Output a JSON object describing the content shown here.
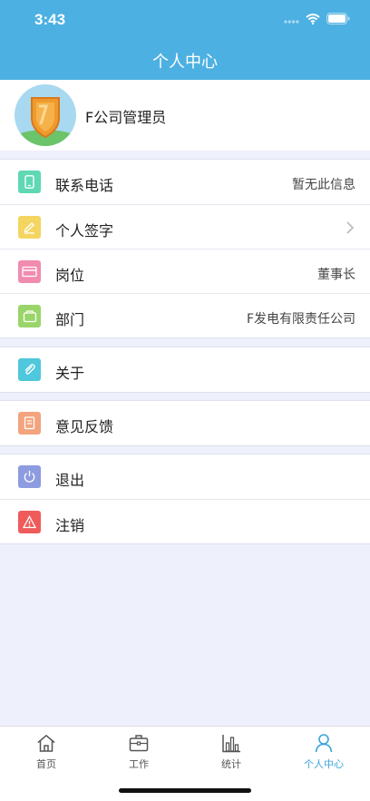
{
  "status_bar": {
    "time": "3:43",
    "icons": [
      "signal-icon",
      "wifi-icon",
      "battery-icon"
    ]
  },
  "header": {
    "title": "个人中心",
    "background": "#4db0e2"
  },
  "profile": {
    "name": "F公司管理员",
    "avatar_icon": "shield-icon"
  },
  "groups": {
    "info": [
      {
        "label": "联系电话",
        "value": "暂无此信息",
        "icon": "phone-icon",
        "color": "#5fd8b4"
      },
      {
        "label": "个人签字",
        "value": "",
        "icon": "pen-icon",
        "color": "#f4d560"
      },
      {
        "label": "岗位",
        "value": "董事长",
        "icon": "card-icon",
        "color": "#f28bb0"
      },
      {
        "label": "部门",
        "value": "F发电有限责任公司",
        "icon": "folder-icon",
        "color": "#9ad56a"
      }
    ],
    "about": [
      {
        "label": "关于",
        "icon": "paperclip-icon",
        "color": "#4fc7dc"
      }
    ],
    "feedback": [
      {
        "label": "意见反馈",
        "icon": "document-icon",
        "color": "#f3a47e"
      }
    ],
    "account": [
      {
        "label": "退出",
        "icon": "power-icon",
        "color": "#8d9be0"
      },
      {
        "label": "注销",
        "icon": "warning-icon",
        "color": "#ef5b5b"
      }
    ]
  },
  "tabbar": {
    "tabs": [
      {
        "label": "首页",
        "icon": "home-icon"
      },
      {
        "label": "工作",
        "icon": "briefcase-icon"
      },
      {
        "label": "统计",
        "icon": "bar-chart-icon"
      },
      {
        "label": "个人中心",
        "icon": "person-icon"
      }
    ],
    "active": "个人中心",
    "active_color": "#3aa3dc"
  }
}
